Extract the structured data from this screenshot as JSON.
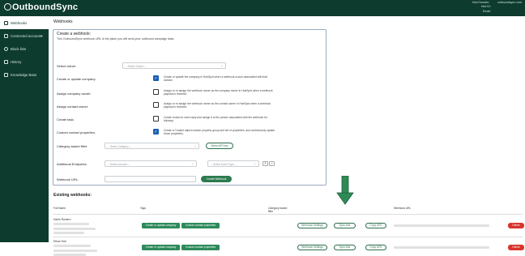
{
  "brand": {
    "name": "OutboundSync"
  },
  "header": {
    "hub_domain_label": "Hub Domain:",
    "hub_domain_value": "outboundsync.com",
    "hub_id_label": "Hub ID:",
    "email_label": "Email:"
  },
  "sidebar": {
    "items": [
      {
        "label": "Webhooks"
      },
      {
        "label": "Connected accounts"
      },
      {
        "label": "Block lists"
      },
      {
        "label": "History"
      },
      {
        "label": "Knowledge Base"
      }
    ]
  },
  "page": {
    "title": "Webhooks"
  },
  "form": {
    "title": "Create a webhook:",
    "subtitle": "This OutboundSync webhook URL is the place you will send your outbound campaign data.",
    "select_owner": {
      "label": "Select owner:",
      "placeholder": "-- Select Owner --"
    },
    "create_company": {
      "label": "Create or update company:",
      "desc": "Create or update the company in HubSpot when a webhook occurs associated with that domain."
    },
    "assign_company_owner": {
      "label": "Assign company owner:",
      "desc": "Assign or re-assign the webhook owner as the company owner in HubSpot when a webhook payload is received."
    },
    "assign_contact_owner": {
      "label": "Assign contact owner:",
      "desc": "Assign or re-assign the webhook owner as the contact owner in HubSpot when a webhook payload is received."
    },
    "create_task": {
      "label": "Create task:",
      "desc": "Create a task for each reply and assign it to the person associated with the webhook for followup."
    },
    "custom_contact": {
      "label": "Custom contact properties:",
      "desc": "Create a Contact object custom property group and set of properties, and continuously update those properties."
    },
    "category_filter": {
      "label": "Category-based filter:",
      "placeholder": "-- Select Category --",
      "api_button": "Select API key"
    },
    "additional_endpoints": {
      "label": "Additional Endpoints:",
      "account_placeholder": "-- Select Account --",
      "type_placeholder": "-- Select Event Type --"
    },
    "webhook_url": {
      "label": "Webhook URL:",
      "create_button": "Create Webhook"
    }
  },
  "existing": {
    "title": "Existing webhooks:",
    "headers": [
      "Full Name",
      "Tags",
      "Category based filter",
      "Webhook URL"
    ],
    "rows": [
      {
        "name": "Harris Romero",
        "tags": [
          "Create or update company",
          "Custom contact properties"
        ],
        "settings": "Webhook Settings",
        "sync": "Sync test",
        "copy": "Copy URL",
        "delete": "Delete"
      },
      {
        "name": "Ethan York",
        "tags": [
          "Create or update company",
          "Custom contact properties"
        ],
        "settings": "Webhook Settings",
        "sync": "Sync test",
        "copy": "Copy URL",
        "delete": "Delete"
      }
    ]
  },
  "colors": {
    "brand_dark": "#0d3b2e",
    "accent_green": "#2d8a5a",
    "delete_red": "#d9342b",
    "arrow_green": "#2f8a56"
  }
}
